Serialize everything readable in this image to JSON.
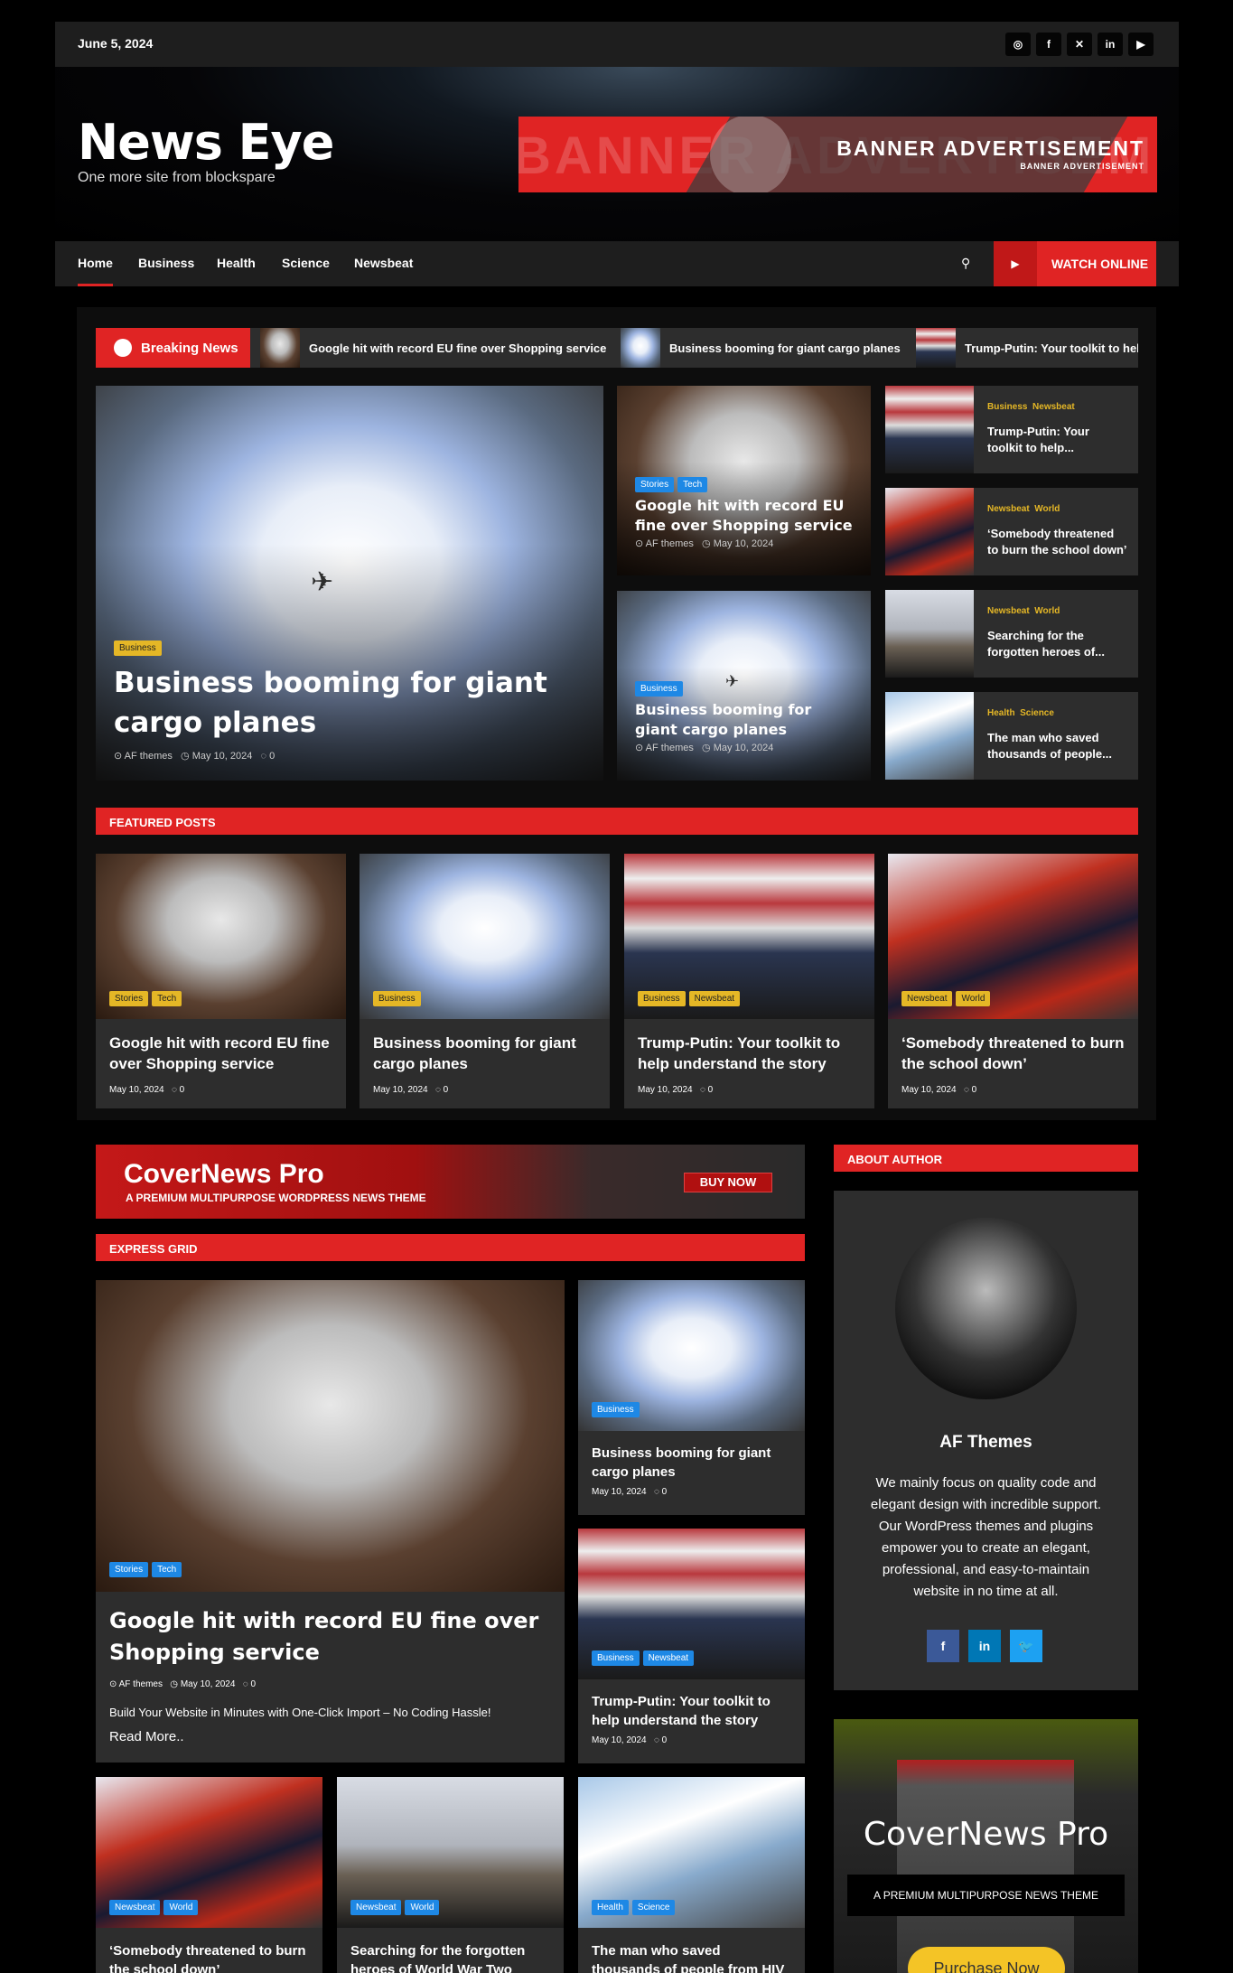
{
  "topbar": {
    "date": "June 5, 2024",
    "social": [
      "instagram-icon",
      "facebook-icon",
      "x-icon",
      "linkedin-icon",
      "youtube-icon"
    ]
  },
  "header": {
    "site_title": "News Eye",
    "tagline": "One more site from blockspare",
    "banner_ghost": "BANNER ADVERTISEMENT",
    "banner_title": "BANNER ADVERTISEMENT",
    "banner_sub": "BANNER ADVERTISEMENT"
  },
  "nav": {
    "items": [
      "Home",
      "Business",
      "Health",
      "Science",
      "Newsbeat"
    ],
    "watch_label": "WATCH ONLINE"
  },
  "breaking": {
    "label": "Breaking News",
    "items": [
      "Google hit with record EU fine over Shopping service",
      "Business booming for giant cargo planes",
      "Trump-Putin: Your toolkit to help understand the story"
    ]
  },
  "hero": {
    "main": {
      "tag": "Business",
      "title": "Business booming for giant cargo planes",
      "author": "AF themes",
      "date": "May 10, 2024",
      "comments": "0"
    },
    "mid": [
      {
        "tags": [
          "Stories",
          "Tech"
        ],
        "title": "Google hit with record EU fine over Shopping service",
        "author": "AF themes",
        "date": "May 10, 2024"
      },
      {
        "tags": [
          "Business"
        ],
        "title": "Business booming for giant cargo planes",
        "author": "AF themes",
        "date": "May 10, 2024"
      }
    ],
    "list": [
      {
        "cats": [
          "Business",
          "Newsbeat"
        ],
        "title": "Trump-Putin: Your toolkit to help..."
      },
      {
        "cats": [
          "Newsbeat",
          "World"
        ],
        "title": "‘Somebody threatened to burn the school down’"
      },
      {
        "cats": [
          "Newsbeat",
          "World"
        ],
        "title": "Searching for the forgotten heroes of..."
      },
      {
        "cats": [
          "Health",
          "Science"
        ],
        "title": "The man who saved thousands of people..."
      }
    ]
  },
  "featured": {
    "heading": "FEATURED POSTS",
    "posts": [
      {
        "tags": [
          "Stories",
          "Tech"
        ],
        "title": "Google hit with record EU fine over Shopping service",
        "date": "May 10, 2024",
        "comments": "0"
      },
      {
        "tags": [
          "Business"
        ],
        "title": "Business booming for giant cargo planes",
        "date": "May 10, 2024",
        "comments": "0"
      },
      {
        "tags": [
          "Business",
          "Newsbeat"
        ],
        "title": "Trump-Putin: Your toolkit to help understand the story",
        "date": "May 10, 2024",
        "comments": "0"
      },
      {
        "tags": [
          "Newsbeat",
          "World"
        ],
        "title": "‘Somebody threatened to burn the school down’",
        "date": "May 10, 2024",
        "comments": "0"
      }
    ]
  },
  "promo": {
    "title": "CoverNews Pro",
    "subtitle": "A PREMIUM MULTIPURPOSE WORDPRESS NEWS THEME",
    "button": "BUY NOW"
  },
  "express": {
    "heading": "EXPRESS GRID",
    "big": {
      "tags": [
        "Stories",
        "Tech"
      ],
      "title": "Google hit with record EU fine over Shopping service",
      "author": "AF themes",
      "date": "May 10, 2024",
      "comments": "0",
      "excerpt": "Build Your Website in Minutes with One-Click Import – No Coding Hassle!",
      "read_more": "Read More.."
    },
    "side": [
      {
        "tags": [
          "Business"
        ],
        "title": "Business booming for giant cargo planes",
        "date": "May 10, 2024",
        "comments": "0"
      },
      {
        "tags": [
          "Business",
          "Newsbeat"
        ],
        "title": "Trump-Putin: Your toolkit to help understand the story",
        "date": "May 10, 2024",
        "comments": "0"
      }
    ],
    "bottom": [
      {
        "tags": [
          "Newsbeat",
          "World"
        ],
        "title": "‘Somebody threatened to burn the school down’"
      },
      {
        "tags": [
          "Newsbeat",
          "World"
        ],
        "title": "Searching for the forgotten heroes of World War Two"
      },
      {
        "tags": [
          "Health",
          "Science"
        ],
        "title": "The man who saved thousands of people from HIV"
      }
    ]
  },
  "author": {
    "heading": "ABOUT AUTHOR",
    "name": "AF Themes",
    "bio": "We mainly focus on quality code and elegant design with incredible support. Our WordPress themes and plugins empower you to create an elegant, professional, and easy-to-maintain website in no time at all.",
    "social": [
      "facebook-icon",
      "linkedin-icon",
      "twitter-icon"
    ]
  },
  "cover_widget": {
    "title": "CoverNews Pro",
    "subtitle": "A PREMIUM MULTIPURPOSE NEWS THEME",
    "button": "Purchase Now"
  },
  "colors": {
    "accent": "#e02424",
    "tag_yellow": "#e5b726",
    "tag_blue": "#1e88e5",
    "card_bg": "#2d2d2d"
  }
}
